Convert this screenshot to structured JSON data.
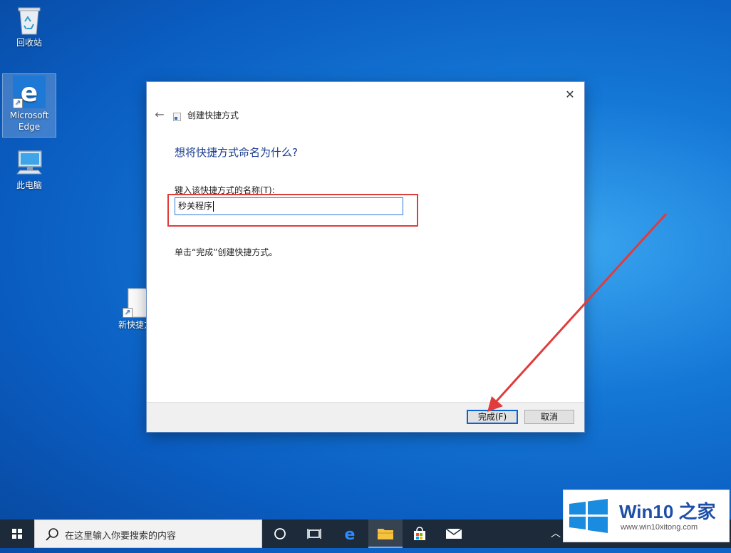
{
  "desktop": {
    "icons": [
      {
        "label": "回收站"
      },
      {
        "label": "Microsoft Edge"
      },
      {
        "label": "此电脑"
      },
      {
        "label": "新快捷方"
      }
    ]
  },
  "dialog": {
    "title": "创建快捷方式",
    "heading": "想将快捷方式命名为什么?",
    "name_label": "键入该快捷方式的名称(T):",
    "name_value": "秒关程序",
    "hint": "单击“完成”创建快捷方式。",
    "finish_label": "完成(F)",
    "cancel_label": "取消"
  },
  "taskbar": {
    "search_placeholder": "在这里输入你要搜索的内容",
    "apps": [
      "task-view",
      "edge",
      "file-explorer",
      "store",
      "mail"
    ]
  },
  "watermark": {
    "brand": "Win10 之家",
    "url": "www.win10xitong.com"
  },
  "colors": {
    "desktop_blue": "#0a5cc0",
    "dialog_heading": "#1a3d8f",
    "annotation_red": "#e03c3c",
    "taskbar": "#1c2a3a"
  }
}
